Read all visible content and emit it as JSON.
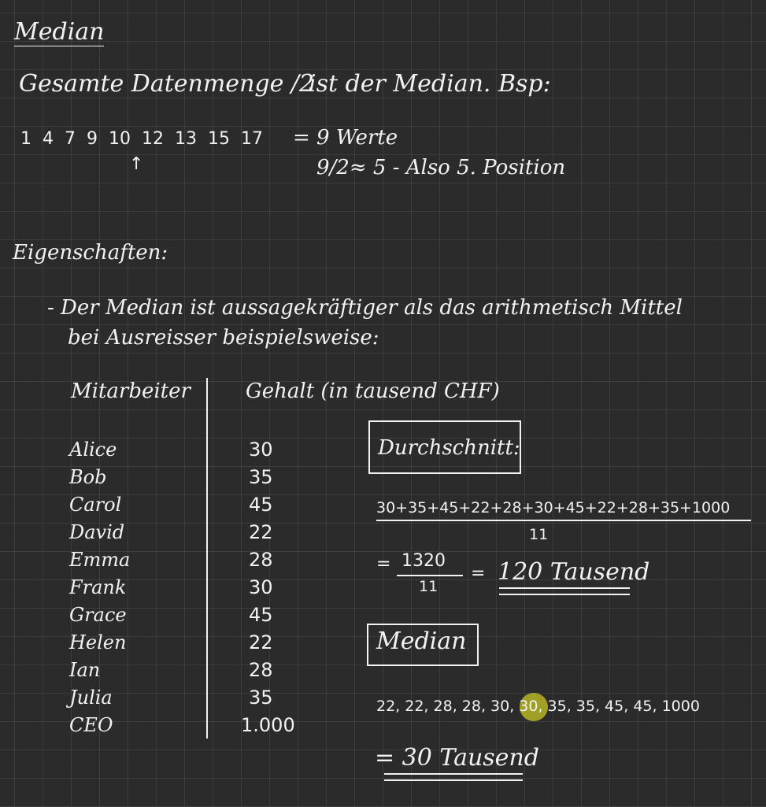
{
  "title": "Median",
  "definition": {
    "part1": "Gesamte Datenmenge /2",
    "part2": "ist der Median. Bsp:"
  },
  "example": {
    "sequence": [
      "1",
      "4",
      "7",
      "9",
      "10",
      "12",
      "13",
      "15",
      "17"
    ],
    "arrow": "↑",
    "equals": "= 9 Werte",
    "explanation": "9/2≈ 5 - Also 5. Position"
  },
  "properties": {
    "heading": "Eigenschaften:",
    "line1": "- Der Median ist aussagekräftiger als das arithmetisch Mittel",
    "line2": "bei Ausreisser beispielsweise:"
  },
  "table": {
    "header_employee": "Mitarbeiter",
    "header_salary": "Gehalt (in tausend CHF)",
    "rows": [
      {
        "name": "Alice",
        "salary": "30"
      },
      {
        "name": "Bob",
        "salary": "35"
      },
      {
        "name": "Carol",
        "salary": "45"
      },
      {
        "name": "David",
        "salary": "22"
      },
      {
        "name": "Emma",
        "salary": "28"
      },
      {
        "name": "Frank",
        "salary": "30"
      },
      {
        "name": "Grace",
        "salary": "45"
      },
      {
        "name": "Helen",
        "salary": "22"
      },
      {
        "name": "Ian",
        "salary": "28"
      },
      {
        "name": "Julia",
        "salary": "35"
      },
      {
        "name": "CEO",
        "salary": "1.000"
      }
    ]
  },
  "average": {
    "label": "Durchschnitt:",
    "numerator": "30+35+45+22+28+30+45+22+28+35+1000",
    "denominator": "11",
    "eq_prefix": "=",
    "frac_num": "1320",
    "frac_den": "11",
    "eq_sign": "=",
    "result": "120 Tausend"
  },
  "median": {
    "label": "Median",
    "sorted_before": "22, 22, 28, 28, 30, ",
    "sorted_highlight": "30",
    "sorted_after": ", 35, 35, 45, 45, 1000",
    "result": "= 30 Tausend"
  },
  "colors": {
    "background": "#2b2b2b",
    "grid": "#3d3d3d",
    "ink": "#f2f2f2",
    "highlight": "#c8c828"
  }
}
